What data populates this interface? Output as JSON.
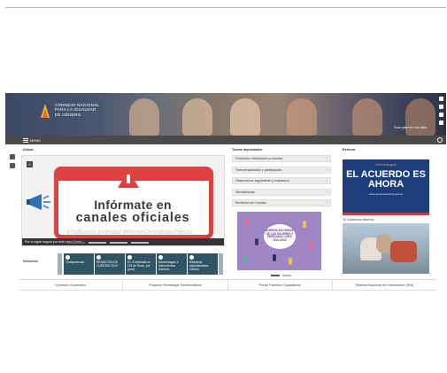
{
  "header": {
    "logo_text_1": "Consejo Nacional",
    "logo_text_2": "para la Igualdad",
    "logo_text_3": "de Género",
    "banner_caption": "Tocar para ver más fotos",
    "menu_label": "MENÚ"
  },
  "slider": {
    "pause_icon": "II",
    "headline_1": "Infórmate en",
    "headline_2": "canales oficiales",
    "hashtags": "#YoBuscoLaVerdad   #FrenteDeNoticiasFalsas",
    "caption": "Por lo sigue seguro por este caso Covid"
  },
  "services": {
    "label": "Servicios",
    "items": [
      {
        "label": "Transparencia"
      },
      {
        "label": "RENDICIÓN DE CUENTAS 2019"
      },
      {
        "label": "Ex. Entrevistas al CM de Rocio, por (part)"
      },
      {
        "label": "Metodologías e Instrumentos técnicos"
      },
      {
        "label": "Biblioteca especializadas Género"
      }
    ]
  },
  "temas": {
    "title": "Temas importantes",
    "items": [
      {
        "label": "Formación, información y estudios"
      },
      {
        "label": "Transversalización y participación"
      },
      {
        "label": "Observancia, seguimiento y evaluación"
      },
      {
        "label": "Normatización"
      },
      {
        "label": "Rendición de Cuentas"
      }
    ],
    "poster_text": "AGENDA NACIONAL DE LAS MUJERES Y PERSONAS LGBTI 2021-2025"
  },
  "right": {
    "title": "Externa",
    "acuerdo_small": "No te arriesgues",
    "acuerdo_big": "EL ACUERDO ES AHORA",
    "acuerdo_info": "www.elacuerdoesahora.gob.ec",
    "gov_title": "Tu Gobierno informa"
  },
  "footer": {
    "links": [
      {
        "label": "Contacto Ciudadano"
      },
      {
        "label": "Proyecto Semanajar Emblemáticos"
      },
      {
        "label": "Portal Trámites Ciudadanos"
      },
      {
        "label": "Sistema Nacional de Información (SNI)"
      }
    ]
  },
  "colors": {
    "nav": "#4a4a4a",
    "service_tile": "#2f5466",
    "warning": "#e04040",
    "acuerdo_bg": "#1e3d7b",
    "poster_bg": "#9f86c4"
  }
}
